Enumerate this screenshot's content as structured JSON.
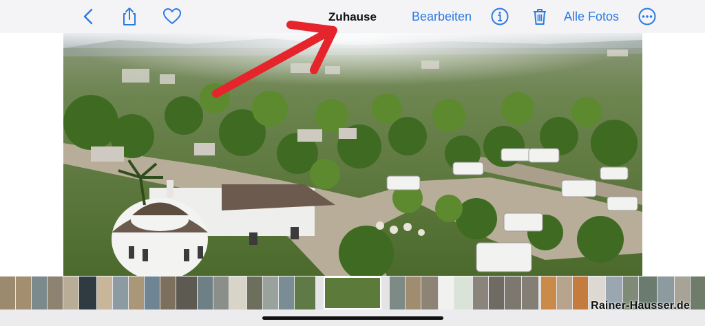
{
  "toolbar": {
    "back_icon": "chevron-left-icon",
    "share_icon": "share-icon",
    "favorite_icon": "heart-icon",
    "title": "Zuhause",
    "edit_label": "Bearbeiten",
    "info_icon": "info-icon",
    "delete_icon": "trash-icon",
    "all_photos_label": "Alle Fotos",
    "more_icon": "ellipsis-circle-icon"
  },
  "annotation": {
    "arrow_color": "#e5242c"
  },
  "colors": {
    "accent": "#2a7ae2",
    "toolbar_bg": "#f4f4f6"
  },
  "filmstrip": {
    "selected_index": 19
  },
  "watermark": "Rainer-Hausser.de"
}
